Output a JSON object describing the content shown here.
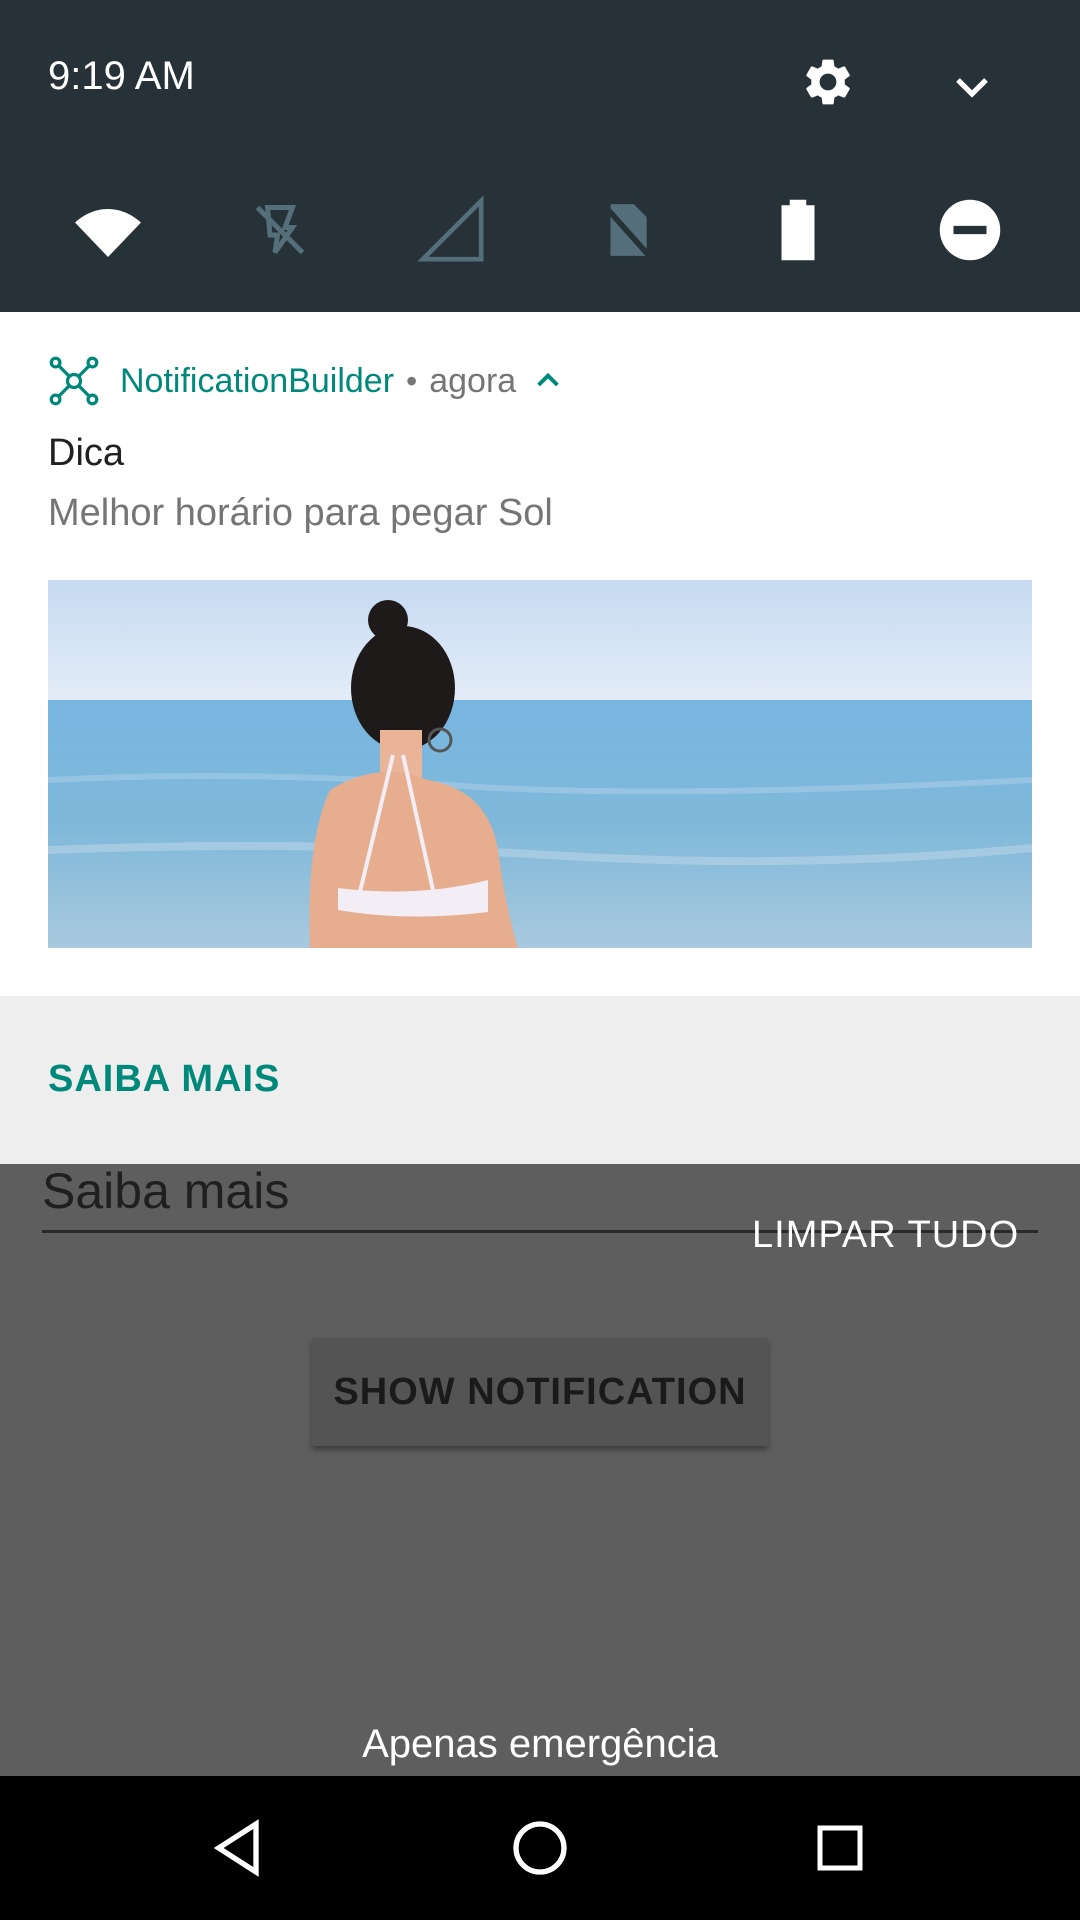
{
  "status": {
    "time": "9:19 AM"
  },
  "quick_settings": {
    "tiles": [
      {
        "icon": "wifi-icon"
      },
      {
        "icon": "flashlight-off-icon"
      },
      {
        "icon": "cell-signal-icon"
      },
      {
        "icon": "no-sim-icon"
      },
      {
        "icon": "battery-icon"
      },
      {
        "icon": "do-not-disturb-icon"
      }
    ]
  },
  "notification": {
    "app_name": "NotificationBuilder",
    "separator": "•",
    "when": "agora",
    "title": "Dica",
    "text": "Melhor horário para pegar Sol",
    "action_label": "SAIBA MAIS"
  },
  "app": {
    "input_text": "Saiba mais",
    "clear_all": "LIMPAR TUDO",
    "show_button": "SHOW NOTIFICATION",
    "emergency_text": "Apenas emergência"
  },
  "colors": {
    "shade": "#263238",
    "accent": "#00897b",
    "scrim": "#5e5e5e"
  }
}
